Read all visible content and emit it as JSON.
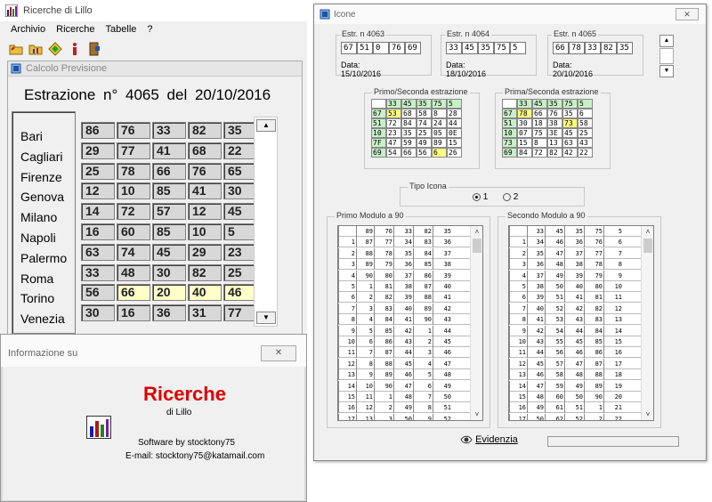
{
  "main_window": {
    "title": "Ricerche di Lillo",
    "menu": [
      "Archivio",
      "Ricerche",
      "Tabelle",
      "?"
    ],
    "toolbar_icons": [
      "open-folder-icon",
      "chart-folder-icon",
      "diamond-icon",
      "info-icon",
      "exit-door-icon"
    ]
  },
  "calcolo": {
    "title": "Calcolo Previsione",
    "heading": "Estrazione n° 4065 del 20/10/2016",
    "cities": [
      "Bari",
      "Cagliari",
      "Firenze",
      "Genova",
      "Milano",
      "Napoli",
      "Palermo",
      "Roma",
      "Torino",
      "Venezia"
    ],
    "rows": [
      [
        "86",
        "76",
        "33",
        "82",
        "35"
      ],
      [
        "29",
        "77",
        "41",
        "68",
        "22"
      ],
      [
        "25",
        "78",
        "66",
        "76",
        "65"
      ],
      [
        "12",
        "10",
        "85",
        "41",
        "30"
      ],
      [
        "14",
        "72",
        "57",
        "12",
        "45"
      ],
      [
        "16",
        "60",
        "85",
        "10",
        "5"
      ],
      [
        "63",
        "74",
        "45",
        "29",
        "23"
      ],
      [
        "33",
        "48",
        "30",
        "82",
        "25"
      ],
      [
        "56",
        "66",
        "20",
        "40",
        "46"
      ],
      [
        "30",
        "16",
        "36",
        "31",
        "77"
      ]
    ],
    "highlight_row": 8,
    "highlight_cols": [
      1,
      2,
      3,
      4
    ]
  },
  "info": {
    "title": "Informazione su",
    "app_name": "Ricerche",
    "subtitle": "di Lillo",
    "software_by": "Software by stocktony75",
    "email": "E-mail: stocktony75@katamail.com",
    "app_name_color": "#e00000"
  },
  "icone": {
    "title": "Icone",
    "close_label": "✕",
    "estrazioni": [
      {
        "label": "Estr. n 4063",
        "nums": [
          "67",
          "51",
          "0",
          "76",
          "69"
        ],
        "date": "Data: 15/10/2016"
      },
      {
        "label": "Estr. n 4064",
        "nums": [
          "33",
          "45",
          "35",
          "75",
          "5"
        ],
        "date": "Data: 18/10/2016"
      },
      {
        "label": "Estr. n 4065",
        "nums": [
          "66",
          "78",
          "33",
          "82",
          "35"
        ],
        "date": "Data: 20/10/2016"
      }
    ],
    "grid1_label": "Primo/Seconda estrazione",
    "grid1": [
      [
        "",
        "33",
        "45",
        "35",
        "75",
        "5"
      ],
      [
        "67",
        "53",
        "68",
        "58",
        "8",
        "28"
      ],
      [
        "51",
        "72",
        "84",
        "74",
        "24",
        "44"
      ],
      [
        "10",
        "23",
        "35",
        "25",
        "05",
        "0E"
      ],
      [
        "7F",
        "47",
        "59",
        "49",
        "89",
        "15"
      ],
      [
        "69",
        "54",
        "66",
        "56",
        "6",
        "26"
      ]
    ],
    "grid2_label": "Prima/Seconda estrazione",
    "grid2": [
      [
        "",
        "33",
        "45",
        "35",
        "75",
        "5"
      ],
      [
        "67",
        "78",
        "66",
        "76",
        "35",
        "6"
      ],
      [
        "51",
        "30",
        "18",
        "38",
        "73",
        "58"
      ],
      [
        "10",
        "07",
        "75",
        "3E",
        "45",
        "25"
      ],
      [
        "73",
        "15",
        "8",
        "13",
        "63",
        "43"
      ],
      [
        "69",
        "84",
        "72",
        "82",
        "42",
        "22"
      ]
    ],
    "tipo_icona_label": "Tipo Icona",
    "tipo_options": [
      "1",
      "2"
    ],
    "list1_label": "Primo Modulo a 90",
    "list2_label": "Secondo Modulo a 90",
    "list1_header": [
      "",
      "89",
      "76",
      "33",
      "82",
      "35"
    ],
    "list1_rows": [
      [
        "1",
        "87",
        "77",
        "34",
        "83",
        "36"
      ],
      [
        "2",
        "88",
        "78",
        "35",
        "84",
        "37"
      ],
      [
        "3",
        "89",
        "79",
        "36",
        "85",
        "38"
      ],
      [
        "4",
        "90",
        "80",
        "37",
        "86",
        "39"
      ],
      [
        "5",
        "1",
        "81",
        "38",
        "87",
        "40"
      ],
      [
        "6",
        "2",
        "82",
        "39",
        "88",
        "41"
      ],
      [
        "7",
        "3",
        "83",
        "40",
        "89",
        "42"
      ],
      [
        "8",
        "4",
        "84",
        "41",
        "90",
        "43"
      ],
      [
        "9",
        "5",
        "85",
        "42",
        "1",
        "44"
      ],
      [
        "10",
        "6",
        "86",
        "43",
        "2",
        "45"
      ],
      [
        "11",
        "7",
        "87",
        "44",
        "3",
        "46"
      ],
      [
        "12",
        "8",
        "88",
        "45",
        "4",
        "47"
      ],
      [
        "13",
        "9",
        "89",
        "46",
        "5",
        "48"
      ],
      [
        "14",
        "10",
        "90",
        "47",
        "6",
        "49"
      ],
      [
        "15",
        "11",
        "1",
        "48",
        "7",
        "50"
      ],
      [
        "16",
        "12",
        "2",
        "49",
        "8",
        "51"
      ],
      [
        "17",
        "13",
        "3",
        "50",
        "9",
        "52"
      ]
    ],
    "list2_header": [
      "",
      "33",
      "45",
      "35",
      "75",
      "5"
    ],
    "list2_rows": [
      [
        "1",
        "34",
        "46",
        "36",
        "76",
        "6"
      ],
      [
        "2",
        "35",
        "47",
        "37",
        "77",
        "7"
      ],
      [
        "3",
        "36",
        "48",
        "38",
        "78",
        "8"
      ],
      [
        "4",
        "37",
        "49",
        "39",
        "79",
        "9"
      ],
      [
        "5",
        "38",
        "50",
        "40",
        "80",
        "10"
      ],
      [
        "6",
        "39",
        "51",
        "41",
        "81",
        "11"
      ],
      [
        "7",
        "40",
        "52",
        "42",
        "82",
        "12"
      ],
      [
        "8",
        "41",
        "53",
        "43",
        "83",
        "13"
      ],
      [
        "9",
        "42",
        "54",
        "44",
        "84",
        "14"
      ],
      [
        "10",
        "43",
        "55",
        "45",
        "85",
        "15"
      ],
      [
        "11",
        "44",
        "56",
        "46",
        "86",
        "16"
      ],
      [
        "12",
        "45",
        "57",
        "47",
        "87",
        "17"
      ],
      [
        "13",
        "46",
        "58",
        "48",
        "88",
        "18"
      ],
      [
        "14",
        "47",
        "59",
        "49",
        "89",
        "19"
      ],
      [
        "15",
        "48",
        "60",
        "50",
        "90",
        "20"
      ],
      [
        "16",
        "49",
        "61",
        "51",
        "1",
        "21"
      ],
      [
        "17",
        "50",
        "62",
        "52",
        "2",
        "22"
      ]
    ],
    "evidenzia_label": "Evidenzia"
  }
}
